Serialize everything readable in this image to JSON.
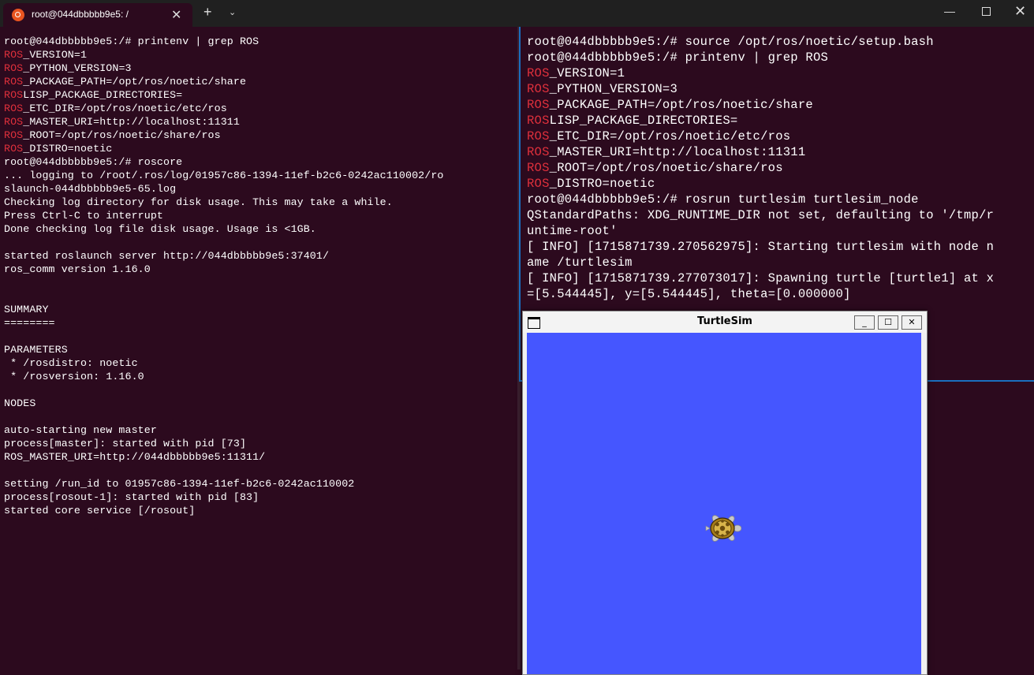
{
  "window": {
    "tab_title": "root@044dbbbbb9e5: /",
    "tab_close_glyph": "✕",
    "new_tab_glyph": "+",
    "dropdown_glyph": "⌄",
    "minimize_glyph": "—",
    "close_glyph": "✕"
  },
  "left_terminal": {
    "lines": [
      {
        "text": "root@044dbbbbb9e5:/# printenv | grep ROS"
      },
      {
        "hl": "ROS",
        "text": "_VERSION=1"
      },
      {
        "hl": "ROS",
        "text": "_PYTHON_VERSION=3"
      },
      {
        "hl": "ROS",
        "text": "_PACKAGE_PATH=/opt/ros/noetic/share"
      },
      {
        "hl": "ROS",
        "text": "LISP_PACKAGE_DIRECTORIES="
      },
      {
        "hl": "ROS",
        "text": "_ETC_DIR=/opt/ros/noetic/etc/ros"
      },
      {
        "hl": "ROS",
        "text": "_MASTER_URI=http://localhost:11311"
      },
      {
        "hl": "ROS",
        "text": "_ROOT=/opt/ros/noetic/share/ros"
      },
      {
        "hl": "ROS",
        "text": "_DISTRO=noetic"
      },
      {
        "text": "root@044dbbbbb9e5:/# roscore"
      },
      {
        "text": "... logging to /root/.ros/log/01957c86-1394-11ef-b2c6-0242ac110002/ro"
      },
      {
        "text": "slaunch-044dbbbbb9e5-65.log"
      },
      {
        "text": "Checking log directory for disk usage. This may take a while."
      },
      {
        "text": "Press Ctrl-C to interrupt"
      },
      {
        "text": "Done checking log file disk usage. Usage is <1GB."
      },
      {
        "text": ""
      },
      {
        "text": "started roslaunch server http://044dbbbbb9e5:37401/"
      },
      {
        "text": "ros_comm version 1.16.0"
      },
      {
        "text": ""
      },
      {
        "text": ""
      },
      {
        "text": "SUMMARY"
      },
      {
        "text": "========"
      },
      {
        "text": ""
      },
      {
        "text": "PARAMETERS"
      },
      {
        "text": " * /rosdistro: noetic"
      },
      {
        "text": " * /rosversion: 1.16.0"
      },
      {
        "text": ""
      },
      {
        "text": "NODES"
      },
      {
        "text": ""
      },
      {
        "text": "auto-starting new master"
      },
      {
        "text": "process[master]: started with pid [73]"
      },
      {
        "text": "ROS_MASTER_URI=http://044dbbbbb9e5:11311/"
      },
      {
        "text": ""
      },
      {
        "text": "setting /run_id to 01957c86-1394-11ef-b2c6-0242ac110002"
      },
      {
        "text": "process[rosout-1]: started with pid [83]"
      },
      {
        "text": "started core service [/rosout]"
      }
    ]
  },
  "right_terminal": {
    "lines": [
      {
        "text": "root@044dbbbbb9e5:/# source /opt/ros/noetic/setup.bash"
      },
      {
        "text": "root@044dbbbbb9e5:/# printenv | grep ROS"
      },
      {
        "hl": "ROS",
        "text": "_VERSION=1"
      },
      {
        "hl": "ROS",
        "text": "_PYTHON_VERSION=3"
      },
      {
        "hl": "ROS",
        "text": "_PACKAGE_PATH=/opt/ros/noetic/share"
      },
      {
        "hl": "ROS",
        "text": "LISP_PACKAGE_DIRECTORIES="
      },
      {
        "hl": "ROS",
        "text": "_ETC_DIR=/opt/ros/noetic/etc/ros"
      },
      {
        "hl": "ROS",
        "text": "_MASTER_URI=http://localhost:11311"
      },
      {
        "hl": "ROS",
        "text": "_ROOT=/opt/ros/noetic/share/ros"
      },
      {
        "hl": "ROS",
        "text": "_DISTRO=noetic"
      },
      {
        "text": "root@044dbbbbb9e5:/# rosrun turtlesim turtlesim_node"
      },
      {
        "text": "QStandardPaths: XDG_RUNTIME_DIR not set, defaulting to '/tmp/r"
      },
      {
        "text": "untime-root'"
      },
      {
        "text": "[ INFO] [1715871739.270562975]: Starting turtlesim with node n"
      },
      {
        "text": "ame /turtlesim"
      },
      {
        "text": "[ INFO] [1715871739.277073017]: Spawning turtle [turtle1] at x"
      },
      {
        "text": "=[5.544445], y=[5.544445], theta=[0.000000]"
      }
    ]
  },
  "turtlesim": {
    "title": "TurtleSim",
    "minimize_glyph": "_",
    "maximize_glyph": "☐",
    "close_glyph": "✕",
    "background_color": "#4556ff",
    "turtle_icon": "turtle-icon"
  },
  "colors": {
    "terminal_bg": "#2c0a1e",
    "highlight": "#e0303c",
    "focus_border": "#1a6fbf"
  }
}
